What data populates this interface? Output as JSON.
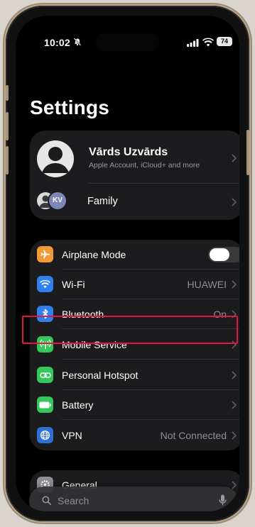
{
  "status": {
    "time": "10:02",
    "battery": "74"
  },
  "page": {
    "title": "Settings"
  },
  "account": {
    "name": "Vārds Uzvārds",
    "subtitle": "Apple Account, iCloud+ and more",
    "family_initials": "KV",
    "family_label": "Family"
  },
  "network": {
    "airplane": {
      "label": "Airplane Mode",
      "on": false
    },
    "wifi": {
      "label": "Wi-Fi",
      "value": "HUAWEI"
    },
    "bluetooth": {
      "label": "Bluetooth",
      "value": "On"
    },
    "mobile": {
      "label": "Mobile Service"
    },
    "hotspot": {
      "label": "Personal Hotspot"
    },
    "battery": {
      "label": "Battery"
    },
    "vpn": {
      "label": "VPN",
      "value": "Not Connected"
    }
  },
  "general": {
    "label": "General"
  },
  "search": {
    "placeholder": "Search"
  },
  "colors": {
    "airplane": "#f09a37",
    "wifi": "#2f80ed",
    "bluetooth": "#2f80ed",
    "mobile": "#34c759",
    "hotspot": "#34c759",
    "battery": "#34c759",
    "vpn": "#2f6fd8",
    "general": "#8e8e93",
    "highlight": "#e2183a"
  },
  "icons": {
    "airplane": "airplane-icon",
    "wifi": "wifi-icon",
    "bluetooth": "bluetooth-icon",
    "mobile": "antenna-icon",
    "hotspot": "link-icon",
    "battery": "battery-icon",
    "vpn": "globe-icon",
    "general": "gear-icon",
    "search": "search-icon",
    "mic": "microphone-icon"
  }
}
